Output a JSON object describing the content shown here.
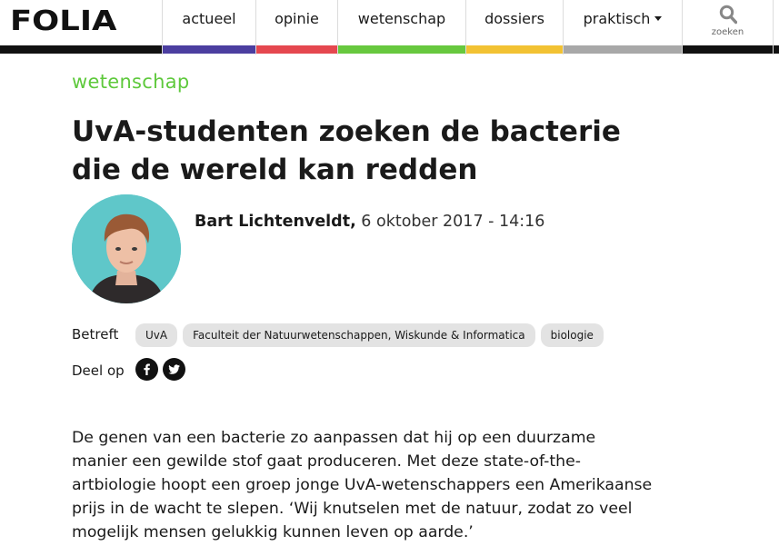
{
  "header": {
    "logo_text": "FOLIA",
    "nav": [
      {
        "label": "actueel",
        "color": "#4b3ea0"
      },
      {
        "label": "opinie",
        "color": "#e5474f"
      },
      {
        "label": "wetenschap",
        "color": "#67c83e"
      },
      {
        "label": "dossiers",
        "color": "#f2c233"
      },
      {
        "label": "praktisch",
        "color": "#a8a8a8",
        "has_dropdown": true
      }
    ],
    "search_label": "zoeken",
    "search_icon": "search-icon"
  },
  "article": {
    "section": "wetenschap",
    "section_color": "#5ec93c",
    "title": "UvA-studenten zoeken de bacterie die de wereld kan redden",
    "author": "Bart Lichtenveldt,",
    "date": " 6 oktober 2017 - 14:16",
    "betreft_label": "Betreft",
    "tags": [
      "UvA",
      "Faculteit der Natuurwetenschappen, Wiskunde & Informatica",
      "biologie"
    ],
    "share_label": "Deel op",
    "share_icons": [
      "facebook-icon",
      "twitter-icon"
    ],
    "intro": "De genen van een bacterie zo aanpassen dat hij op een duurzame manier een gewilde stof gaat produceren. Met deze state-of-the-artbiologie hoopt een groep jonge UvA-wetenschappers een Amerikaanse prijs in de wacht te slepen. ‘Wij knutselen met de natuur, zodat zo veel mogelijk mensen gelukkig kunnen leven op aarde.’"
  }
}
